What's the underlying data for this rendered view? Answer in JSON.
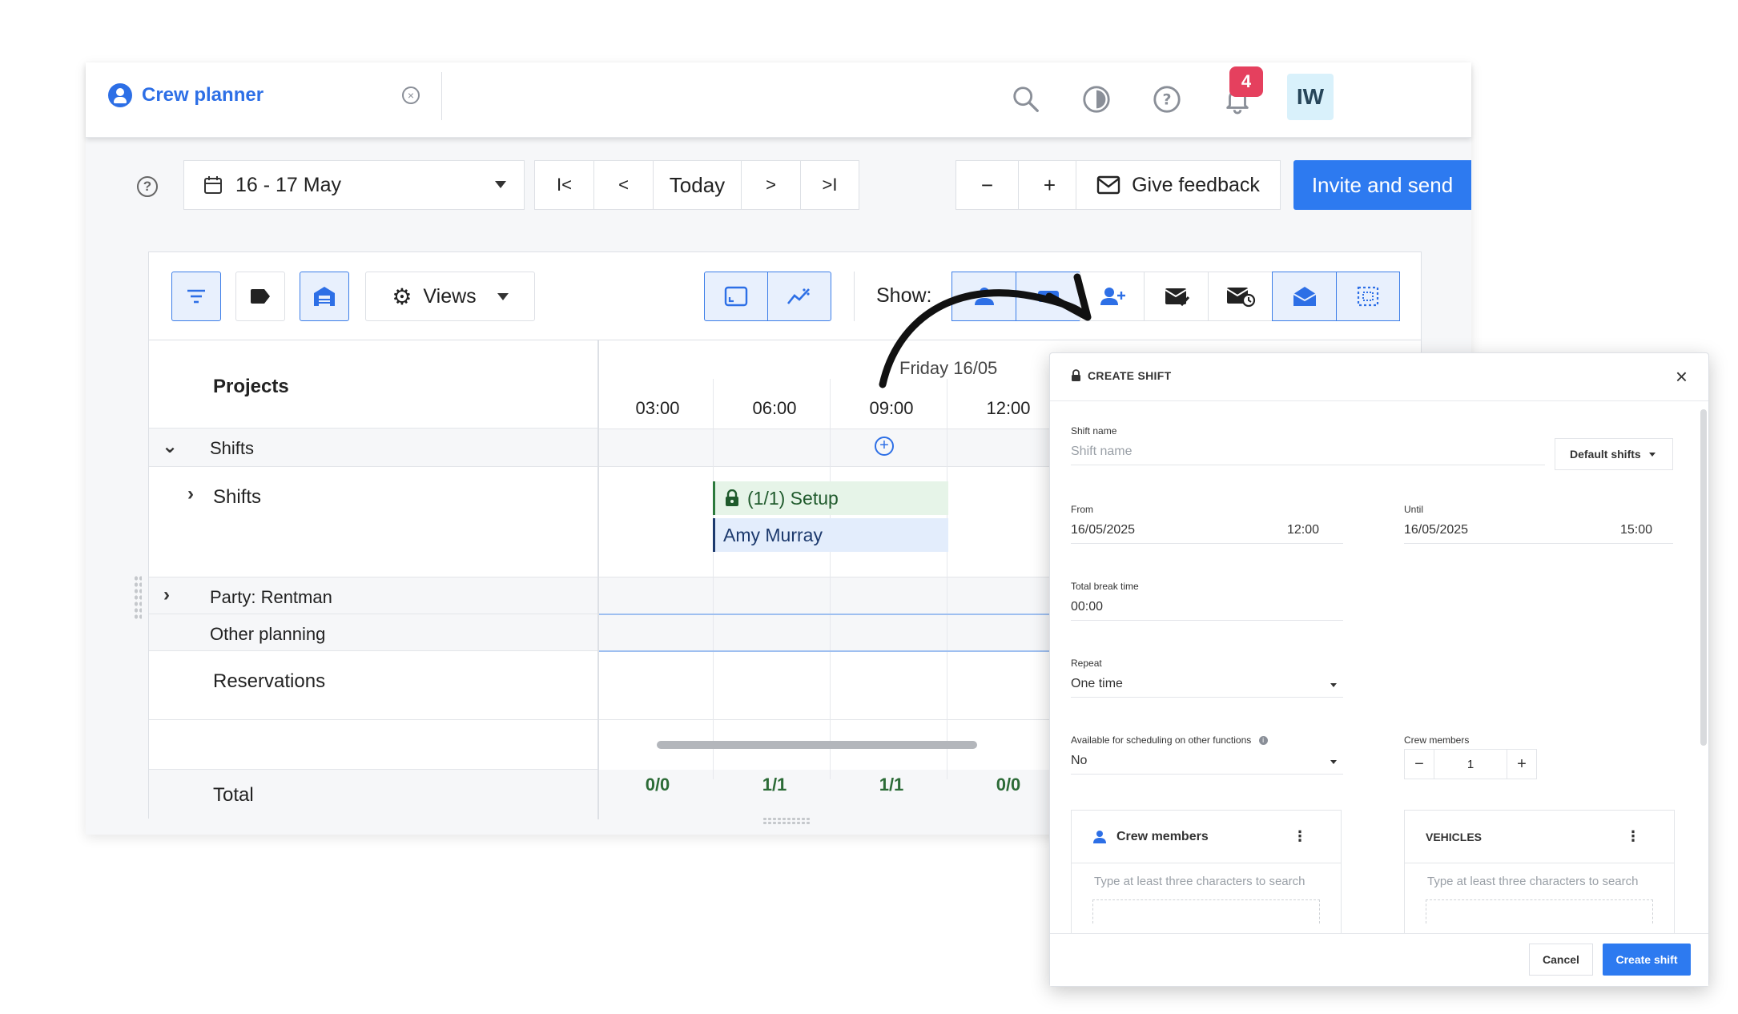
{
  "colors": {
    "accent": "#2d7af0",
    "badge": "#e5405e",
    "shift_green": "#2c7a3d",
    "person_navy": "#1d3a6e"
  },
  "tab": {
    "title": "Crew planner",
    "close_icon": "close-circle-icon"
  },
  "header": {
    "notification_count": "4",
    "avatar_initials": "IW"
  },
  "toolbar": {
    "date_range": "16 - 17 May",
    "today": "Today",
    "feedback": "Give feedback",
    "invite": "Invite and send",
    "first": "I<",
    "prev": "<",
    "next": ">",
    "last": ">I",
    "zoom_out": "−",
    "zoom_in": "+"
  },
  "planner": {
    "views_label": "Views",
    "show_label": "Show:",
    "projects_header": "Projects",
    "day_label": "Friday 16/05",
    "times": [
      "03:00",
      "06:00",
      "09:00",
      "12:00"
    ],
    "rows": {
      "shifts_group": "Shifts",
      "shifts_sub": "Shifts",
      "party": "Party: Rentman",
      "other": "Other planning",
      "reservations": "Reservations",
      "total": "Total"
    },
    "shift_bar": "(1/1) Setup",
    "person_bar": "Amy Murray",
    "totals": [
      "0/0",
      "1/1",
      "1/1",
      "0/0"
    ]
  },
  "modal": {
    "title": "CREATE SHIFT",
    "shift_name_label": "Shift name",
    "shift_name_placeholder": "Shift name",
    "default_shifts": "Default shifts",
    "from_label": "From",
    "from_date": "16/05/2025",
    "from_time": "12:00",
    "until_label": "Until",
    "until_date": "16/05/2025",
    "until_time": "15:00",
    "break_label": "Total break time",
    "break_value": "00:00",
    "repeat_label": "Repeat",
    "repeat_value": "One time",
    "available_label": "Available for scheduling on other functions",
    "available_value": "No",
    "crew_count_label": "Crew members",
    "crew_count_value": "1",
    "crew_panel_title": "Crew members",
    "crew_search_placeholder": "Type at least three characters to search",
    "vehicles_panel_title": "VEHICLES",
    "vehicles_search_placeholder": "Type at least three characters to search",
    "cancel": "Cancel",
    "create": "Create shift"
  }
}
